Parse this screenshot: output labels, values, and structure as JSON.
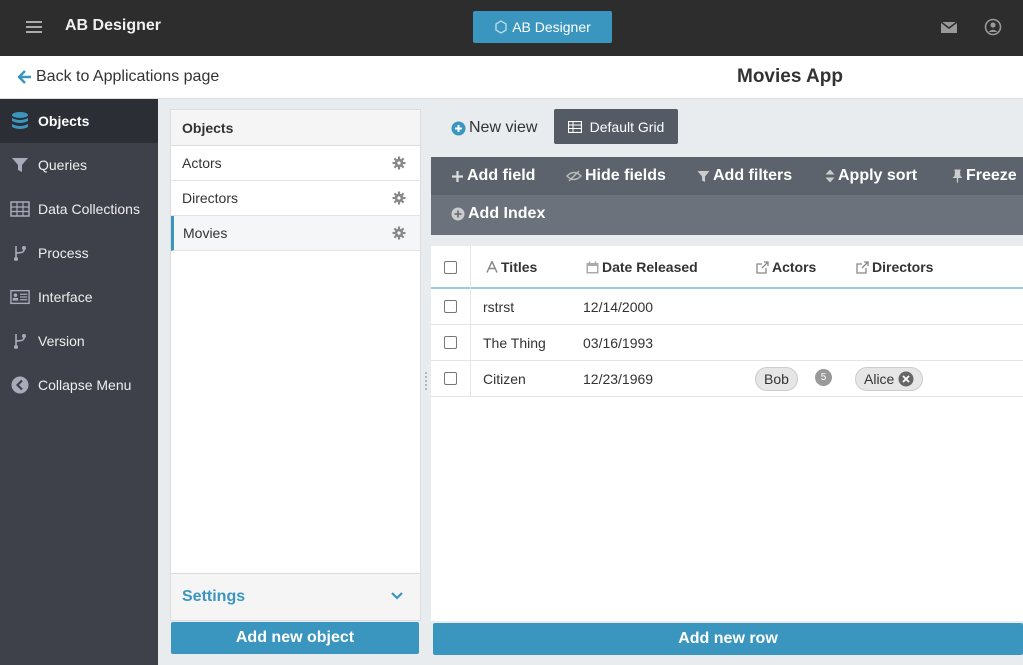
{
  "topbar": {
    "app_name": "AB Designer",
    "center_button": "AB Designer",
    "icons": [
      "menu-icon",
      "mail-icon",
      "user-icon"
    ]
  },
  "subheader": {
    "back_link": "Back to Applications page",
    "app_title": "Movies App"
  },
  "sidebar": {
    "items": [
      {
        "label": "Objects",
        "icon": "database-icon",
        "active": true
      },
      {
        "label": "Queries",
        "icon": "filter-icon"
      },
      {
        "label": "Data Collections",
        "icon": "table-icon"
      },
      {
        "label": "Process",
        "icon": "process-icon"
      },
      {
        "label": "Interface",
        "icon": "interface-icon"
      },
      {
        "label": "Version",
        "icon": "version-icon"
      },
      {
        "label": "Collapse Menu",
        "icon": "collapse-icon"
      }
    ]
  },
  "objects_panel": {
    "header": "Objects",
    "items": [
      "Actors",
      "Directors",
      "Movies"
    ],
    "active": "Movies",
    "settings_label": "Settings",
    "add_button": "Add new object"
  },
  "views": {
    "new_view": "New view",
    "default_grid": "Default Grid"
  },
  "toolbar": {
    "add_field": "Add field",
    "hide_fields": "Hide fields",
    "add_filters": "Add filters",
    "apply_sort": "Apply sort",
    "freeze": "Freeze",
    "add_index": "Add Index"
  },
  "grid": {
    "columns": [
      "Titles",
      "Date Released",
      "Actors",
      "Directors"
    ],
    "rows": [
      {
        "title": "rstrst",
        "date": "12/14/2000",
        "actors": "",
        "directors": ""
      },
      {
        "title": "The Thing",
        "date": "03/16/1993",
        "actors": "",
        "directors": ""
      },
      {
        "title": "Citizen",
        "date": "12/23/1969",
        "actors": "Bob",
        "actor_count": "5",
        "directors": "Alice"
      }
    ],
    "add_row_button": "Add new row"
  },
  "colors": {
    "accent": "#3b96bf",
    "topbar": "#2d2d2d",
    "sidebar": "#3e4149",
    "toolbar": "#5c636c"
  }
}
